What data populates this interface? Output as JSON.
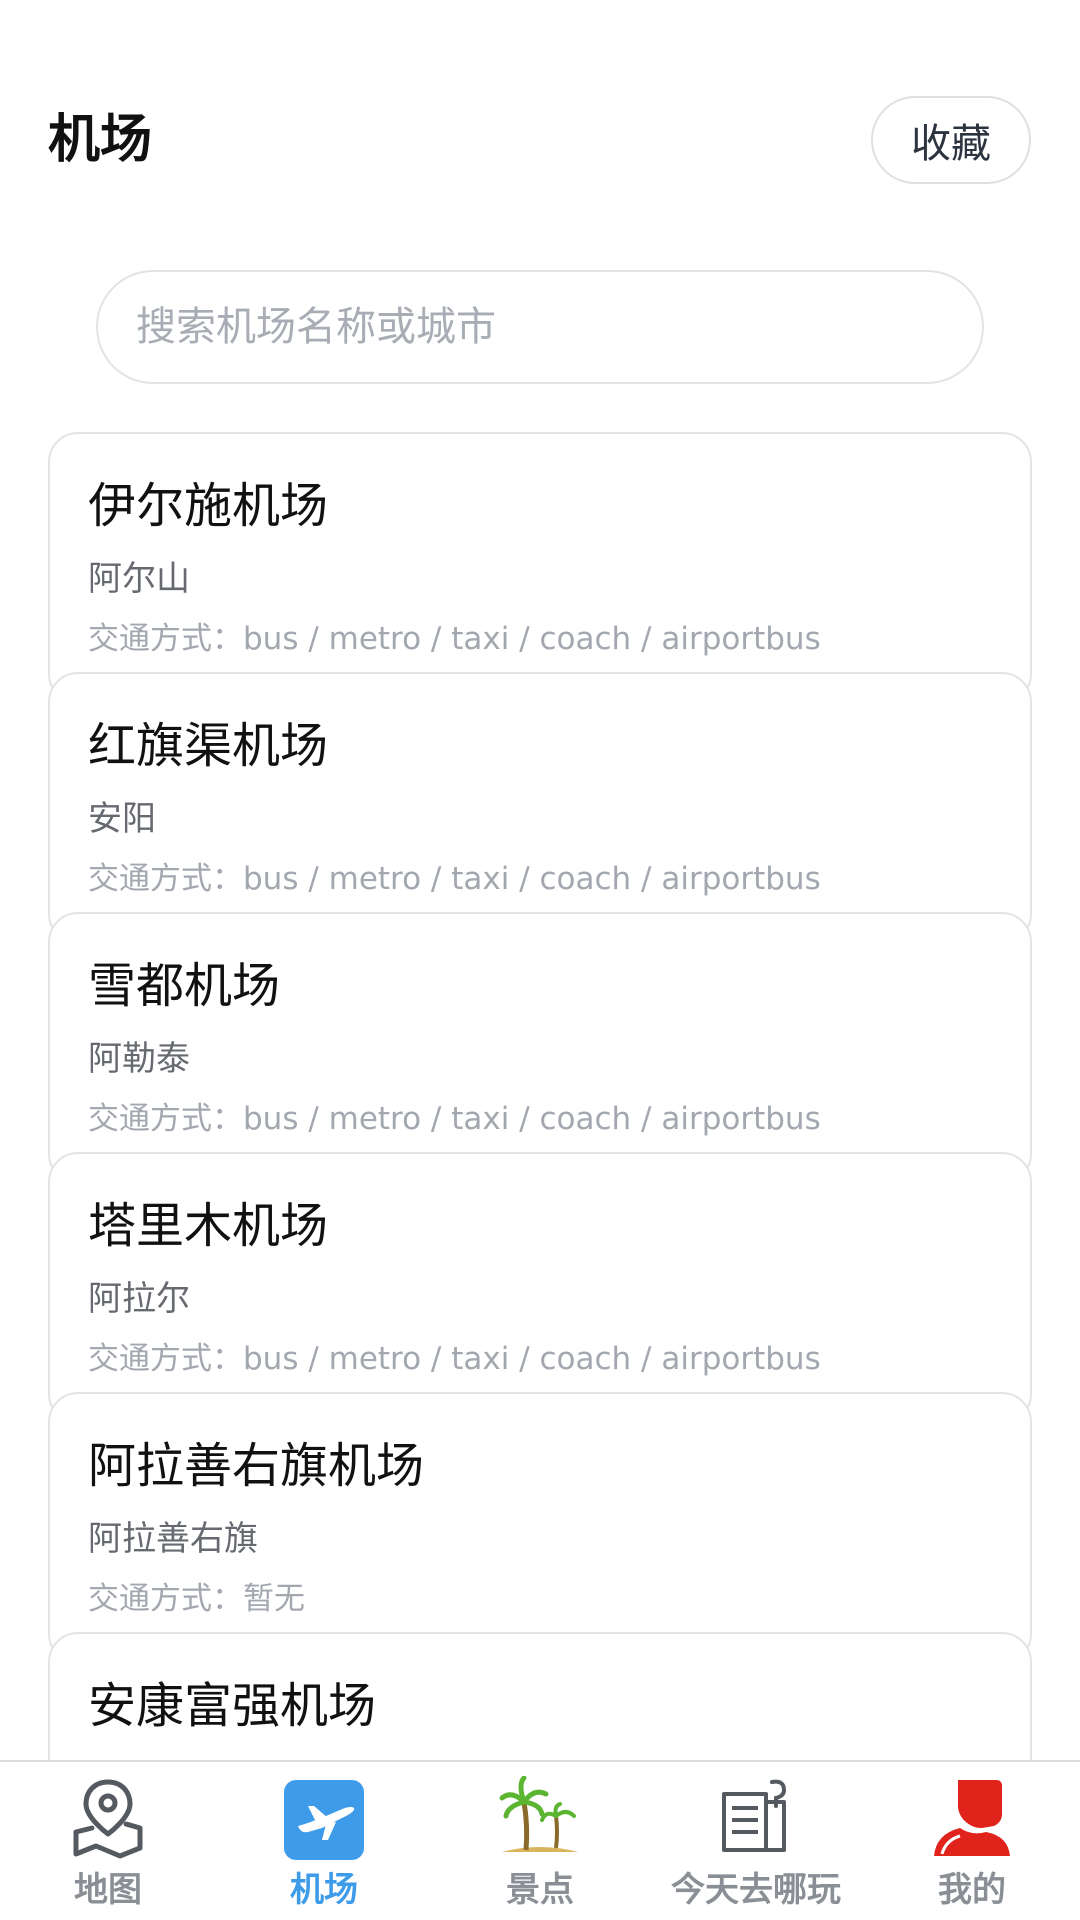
{
  "header": {
    "title": "机场",
    "favorites_label": "收藏"
  },
  "search": {
    "placeholder": "搜索机场名称或城市",
    "value": ""
  },
  "airports": [
    {
      "name": "伊尔施机场",
      "city": "阿尔山",
      "transport": "交通方式：bus / metro / taxi / coach / airportbus"
    },
    {
      "name": "红旗渠机场",
      "city": "安阳",
      "transport": "交通方式：bus / metro / taxi / coach / airportbus"
    },
    {
      "name": "雪都机场",
      "city": "阿勒泰",
      "transport": "交通方式：bus / metro / taxi / coach / airportbus"
    },
    {
      "name": "塔里木机场",
      "city": "阿拉尔",
      "transport": "交通方式：bus / metro / taxi / coach / airportbus"
    },
    {
      "name": "阿拉善右旗机场",
      "city": "阿拉善右旗",
      "transport": "交通方式：暂无"
    },
    {
      "name": "安康富强机场",
      "city": "",
      "transport": ""
    }
  ],
  "tabbar": {
    "tabs": [
      {
        "label": "地图",
        "icon": "map-pin-icon",
        "active": false
      },
      {
        "label": "机场",
        "icon": "airplane-icon",
        "active": true
      },
      {
        "label": "景点",
        "icon": "palm-tree-icon",
        "active": false
      },
      {
        "label": "今天去哪玩",
        "icon": "document-icon",
        "active": false
      },
      {
        "label": "我的",
        "icon": "user-icon",
        "active": false
      }
    ]
  },
  "colors": {
    "accent": "#3d9be9",
    "user_icon": "#e0231b",
    "palm": "#5bb531",
    "inactive_text": "#8a8f96"
  }
}
